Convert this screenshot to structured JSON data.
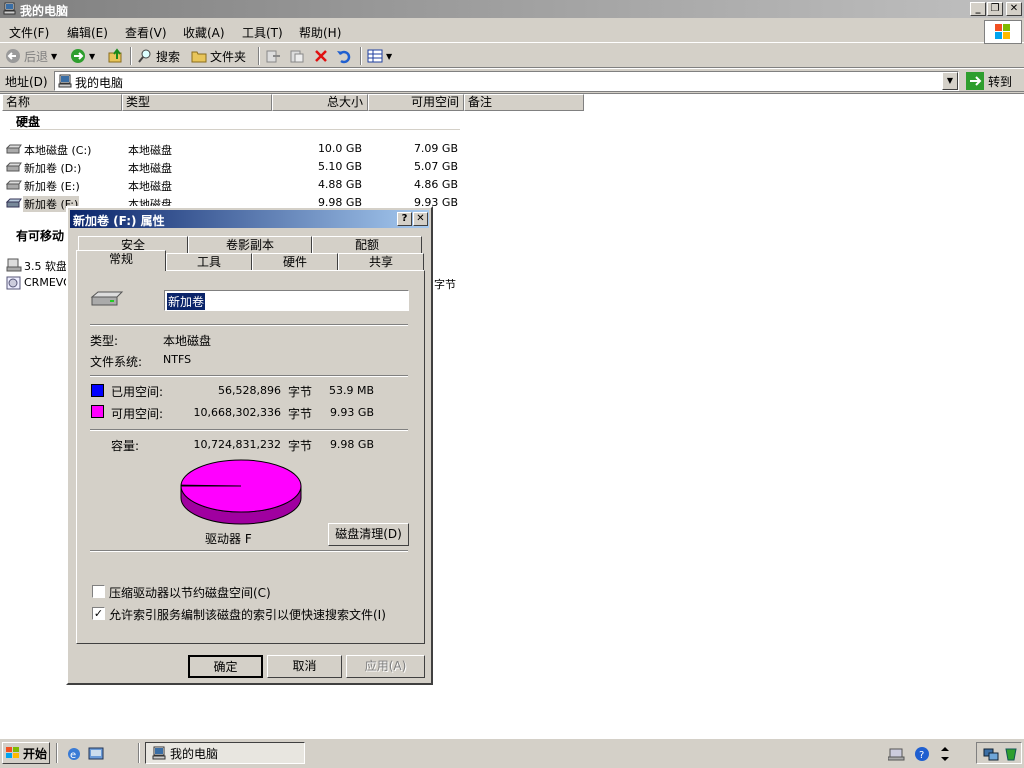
{
  "window": {
    "title": "我的电脑"
  },
  "menu": [
    "文件(F)",
    "编辑(E)",
    "查看(V)",
    "收藏(A)",
    "工具(T)",
    "帮助(H)"
  ],
  "toolbar": {
    "back": "后退",
    "search": "搜索",
    "folders": "文件夹"
  },
  "address": {
    "label": "地址(D)",
    "value": "我的电脑",
    "go": "转到"
  },
  "columns": [
    "名称",
    "类型",
    "总大小",
    "可用空间",
    "备注"
  ],
  "groups": {
    "hdd": "硬盘",
    "removable": "有可移动"
  },
  "drives": [
    {
      "name": "本地磁盘 (C:)",
      "type": "本地磁盘",
      "total": "10.0 GB",
      "free": "7.09 GB"
    },
    {
      "name": "新加卷 (D:)",
      "type": "本地磁盘",
      "total": "5.10 GB",
      "free": "5.07 GB"
    },
    {
      "name": "新加卷 (E:)",
      "type": "本地磁盘",
      "total": "4.88 GB",
      "free": "4.86 GB"
    },
    {
      "name": "新加卷 (F:)",
      "type": "本地磁盘",
      "total": "9.98 GB",
      "free": "9.93 GB"
    }
  ],
  "removable": [
    {
      "name": "3.5 软盘"
    },
    {
      "name": "CRMEVOL",
      "tail": "字节"
    }
  ],
  "dialog": {
    "title": "新加卷 (F:) 属性",
    "tabs_back": [
      "安全",
      "卷影副本",
      "配额"
    ],
    "tabs_front": [
      "常规",
      "工具",
      "硬件",
      "共享"
    ],
    "volume_name": "新加卷",
    "type_label": "类型:",
    "type_value": "本地磁盘",
    "fs_label": "文件系统:",
    "fs_value": "NTFS",
    "used_label": "已用空间:",
    "used_bytes": "56,528,896",
    "used_size": "53.9 MB",
    "free_label": "可用空间:",
    "free_bytes": "10,668,302,336",
    "free_size": "9.93 GB",
    "cap_label": "容量:",
    "cap_bytes": "10,724,831,232",
    "cap_size": "9.98 GB",
    "bytes_unit": "字节",
    "drive_label": "驱动器 F",
    "cleanup": "磁盘清理(D)",
    "compress": "压缩驱动器以节约磁盘空间(C)",
    "index": "允许索引服务编制该磁盘的索引以便快速搜索文件(I)",
    "ok": "确定",
    "cancel": "取消",
    "apply": "应用(A)",
    "used_fraction": 0.0053,
    "colors": {
      "used": "#0000ff",
      "free": "#ff00ff"
    }
  },
  "taskbar": {
    "start": "开始",
    "task": "我的电脑"
  }
}
